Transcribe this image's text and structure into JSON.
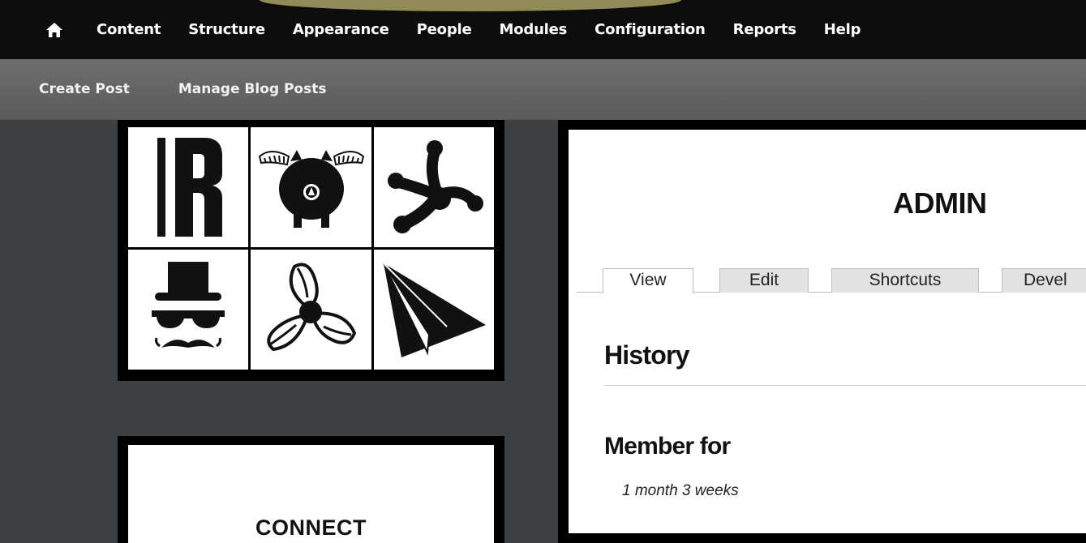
{
  "toolbar": {
    "home_icon": "home-icon",
    "menu": [
      "Content",
      "Structure",
      "Appearance",
      "People",
      "Modules",
      "Configuration",
      "Reports",
      "Help"
    ]
  },
  "shortcuts": [
    "Create Post",
    "Manage Blog Posts"
  ],
  "sidebar": {
    "logo_tiles": [
      "r-letter-icon",
      "winged-pig-icon",
      "frog-foot-icon",
      "top-hat-mustache-icon",
      "propeller-icon",
      "paper-plane-icon"
    ],
    "connect_title": "CONNECT"
  },
  "main": {
    "user_title": "ADMIN",
    "tabs": [
      {
        "label": "View",
        "active": true
      },
      {
        "label": "Edit",
        "active": false
      },
      {
        "label": "Shortcuts",
        "active": false
      },
      {
        "label": "Devel",
        "active": false
      }
    ],
    "history_heading": "History",
    "member_heading": "Member for",
    "member_value": "1 month 3 weeks"
  },
  "colors": {
    "toolbar_bg": "#0d0d0d",
    "shortcut_bg": "#636363",
    "page_bg": "#3f4042",
    "highlight": "#fff696"
  }
}
